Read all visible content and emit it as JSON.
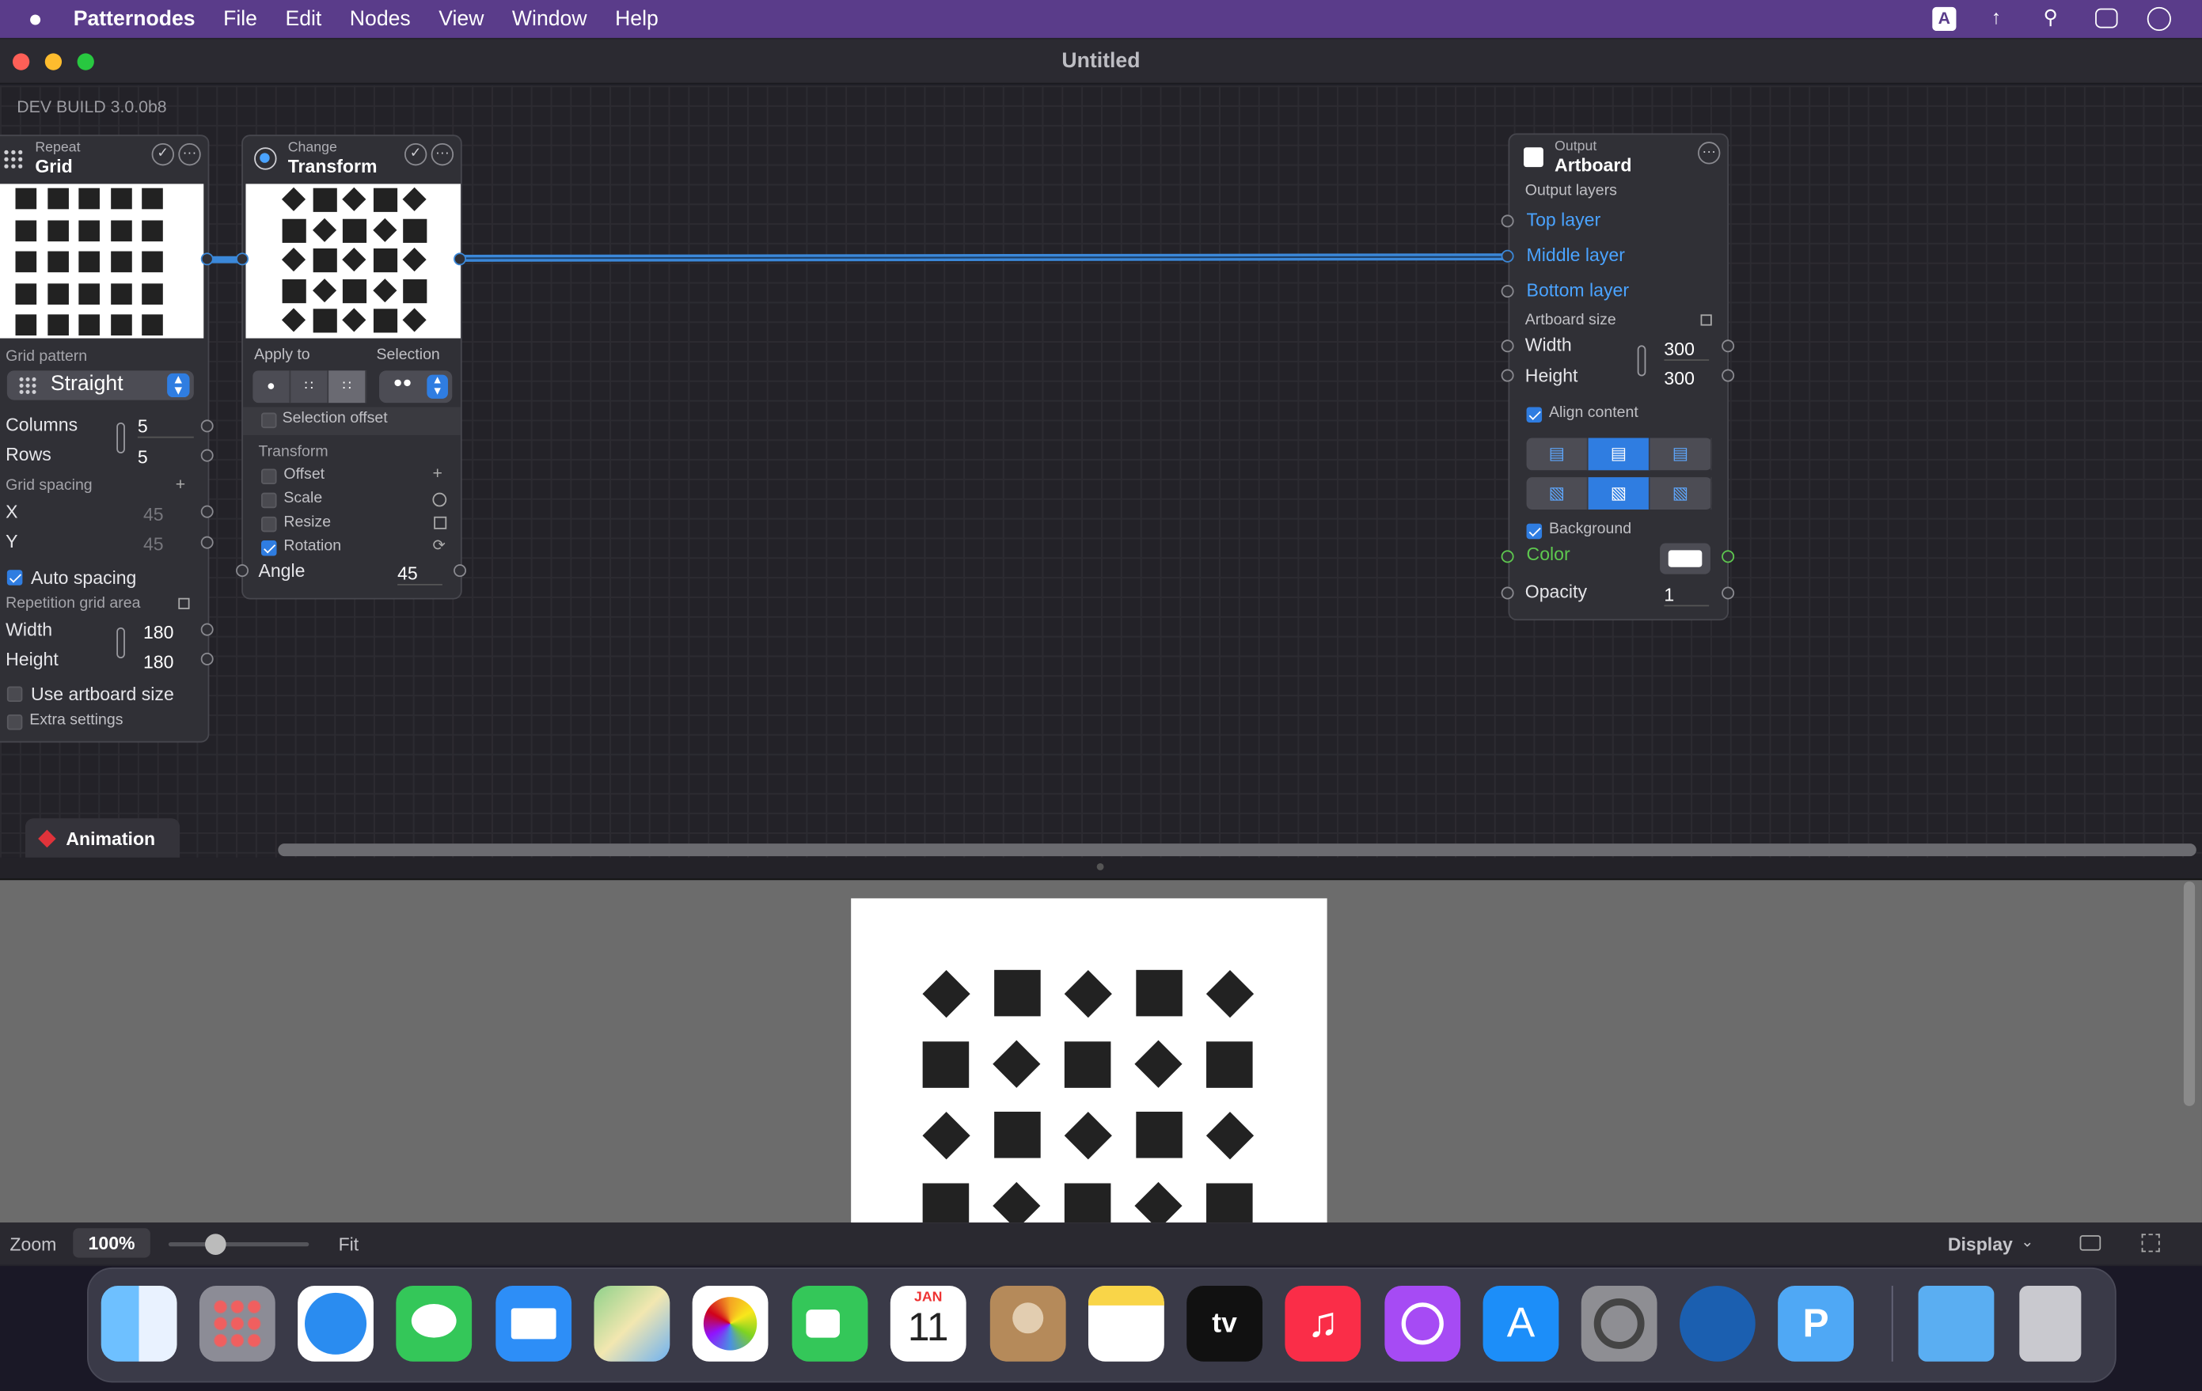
{
  "menubar": {
    "app": "Patternodes",
    "items": [
      "File",
      "Edit",
      "Nodes",
      "View",
      "Window",
      "Help"
    ]
  },
  "window": {
    "title": "Untitled",
    "build": "DEV BUILD 3.0.0b8"
  },
  "grid_node": {
    "category": "Repeat",
    "name": "Grid",
    "grid_pattern_label": "Grid pattern",
    "grid_pattern": "Straight",
    "columns_label": "Columns",
    "columns": "5",
    "rows_label": "Rows",
    "rows": "5",
    "spacing_label": "Grid spacing",
    "x_label": "X",
    "x": "45",
    "y_label": "Y",
    "y": "45",
    "auto_spacing": "Auto spacing",
    "area_label": "Repetition grid area",
    "width_label": "Width",
    "width": "180",
    "height_label": "Height",
    "height": "180",
    "use_artboard": "Use artboard size",
    "extra": "Extra settings"
  },
  "transform_node": {
    "category": "Change",
    "name": "Transform",
    "apply_to": "Apply to",
    "selection": "Selection",
    "selection_offset": "Selection offset",
    "transform_label": "Transform",
    "offset": "Offset",
    "scale": "Scale",
    "resize": "Resize",
    "rotation": "Rotation",
    "angle_label": "Angle",
    "angle": "45"
  },
  "output_node": {
    "category": "Output",
    "name": "Artboard",
    "output_layers": "Output layers",
    "top_layer": "Top layer",
    "middle_layer": "Middle layer",
    "bottom_layer": "Bottom layer",
    "artboard_size": "Artboard size",
    "width_label": "Width",
    "width": "300",
    "height_label": "Height",
    "height": "300",
    "align_content": "Align content",
    "background": "Background",
    "color_label": "Color",
    "opacity_label": "Opacity",
    "opacity": "1"
  },
  "animation_tab": "Animation",
  "zoom": {
    "label": "Zoom",
    "value": "100%",
    "fit": "Fit",
    "display": "Display",
    "slider_fraction": 0.3
  },
  "calendar": {
    "month": "JAN",
    "day": "11"
  },
  "colors": {
    "accent": "#2f7de1",
    "menubar": "#5a3c8a",
    "link": "#4aa3ff"
  }
}
